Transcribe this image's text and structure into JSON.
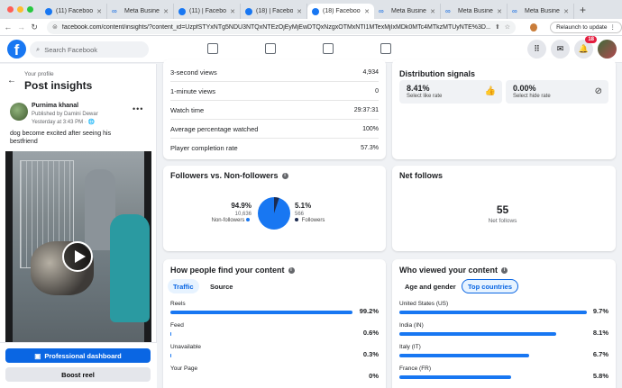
{
  "browser": {
    "tabs": [
      {
        "title": "(11) Facebook",
        "type": "fb",
        "active": false
      },
      {
        "title": "Meta Business",
        "type": "meta",
        "active": false
      },
      {
        "title": "(11) | Facebook",
        "type": "fb",
        "active": false
      },
      {
        "title": "(18) | Facebook",
        "type": "fb",
        "active": false
      },
      {
        "title": "(18) Facebook",
        "type": "fb",
        "active": true
      },
      {
        "title": "Meta Business",
        "type": "meta",
        "active": false
      },
      {
        "title": "Meta Business",
        "type": "meta",
        "active": false
      },
      {
        "title": "Meta Business",
        "type": "meta",
        "active": false
      }
    ],
    "url": "facebook.com/content/insights/?content_id=UzpfSTYxNTg5NDU3NTQxNTEzOjEyMjEwDTQxNzgxOTMxNTI1MTexMjIxMDk0MTc4MTkzMTUyNTE%3D...",
    "relaunch_label": "Relaunch to update",
    "new_tab": "+"
  },
  "fb": {
    "search_placeholder": "Search Facebook",
    "notification_count": "18"
  },
  "left": {
    "your_profile": "Your profile",
    "title": "Post insights",
    "author": "Purnima khanal",
    "published_by": "Published by Damini Dewar",
    "date": "Yesterday at 3:43 PM · 🌐",
    "caption": "dog become excited after seeing his bestfriend",
    "dashboard_button": "Professional dashboard",
    "boost_button": "Boost reel"
  },
  "metrics": [
    {
      "label": "3-second views",
      "value": "4,934"
    },
    {
      "label": "1-minute views",
      "value": "0"
    },
    {
      "label": "Watch time",
      "value": "29:37:31"
    },
    {
      "label": "Average percentage watched",
      "value": "100%"
    },
    {
      "label": "Player completion rate",
      "value": "57.3%"
    }
  ],
  "distribution": {
    "title": "Distribution signals",
    "like_rate": "8.41%",
    "like_label": "Select like rate",
    "hide_rate": "0.00%",
    "hide_label": "Select hide rate"
  },
  "followers": {
    "title": "Followers vs. Non-followers",
    "non_followers_pct": "94.9%",
    "non_followers_count": "10,636",
    "non_followers_label": "Non-followers",
    "followers_pct": "5.1%",
    "followers_count": "566",
    "followers_label": "Followers",
    "color_non": "#1877f2",
    "color_fol": "#1c2b50"
  },
  "net_follows": {
    "title": "Net follows",
    "value": "55",
    "label": "Net follows"
  },
  "find": {
    "title": "How people find your content",
    "tabs": [
      "Traffic",
      "Source"
    ],
    "rows": [
      {
        "label": "Reels",
        "value": "99.2%",
        "frac": 0.992
      },
      {
        "label": "Feed",
        "value": "0.6%",
        "frac": 0.006
      },
      {
        "label": "Unavailable",
        "value": "0.3%",
        "frac": 0.003
      },
      {
        "label": "Your Page",
        "value": "0%",
        "frac": 0.0
      }
    ]
  },
  "who": {
    "title": "Who viewed your content",
    "tabs": [
      "Age and gender",
      "Top countries"
    ],
    "rows": [
      {
        "label": "United States (US)",
        "value": "9.7%",
        "frac": 1.0
      },
      {
        "label": "India (IN)",
        "value": "8.1%",
        "frac": 0.835
      },
      {
        "label": "Italy (IT)",
        "value": "6.7%",
        "frac": 0.69
      },
      {
        "label": "France (FR)",
        "value": "5.8%",
        "frac": 0.598
      }
    ]
  }
}
